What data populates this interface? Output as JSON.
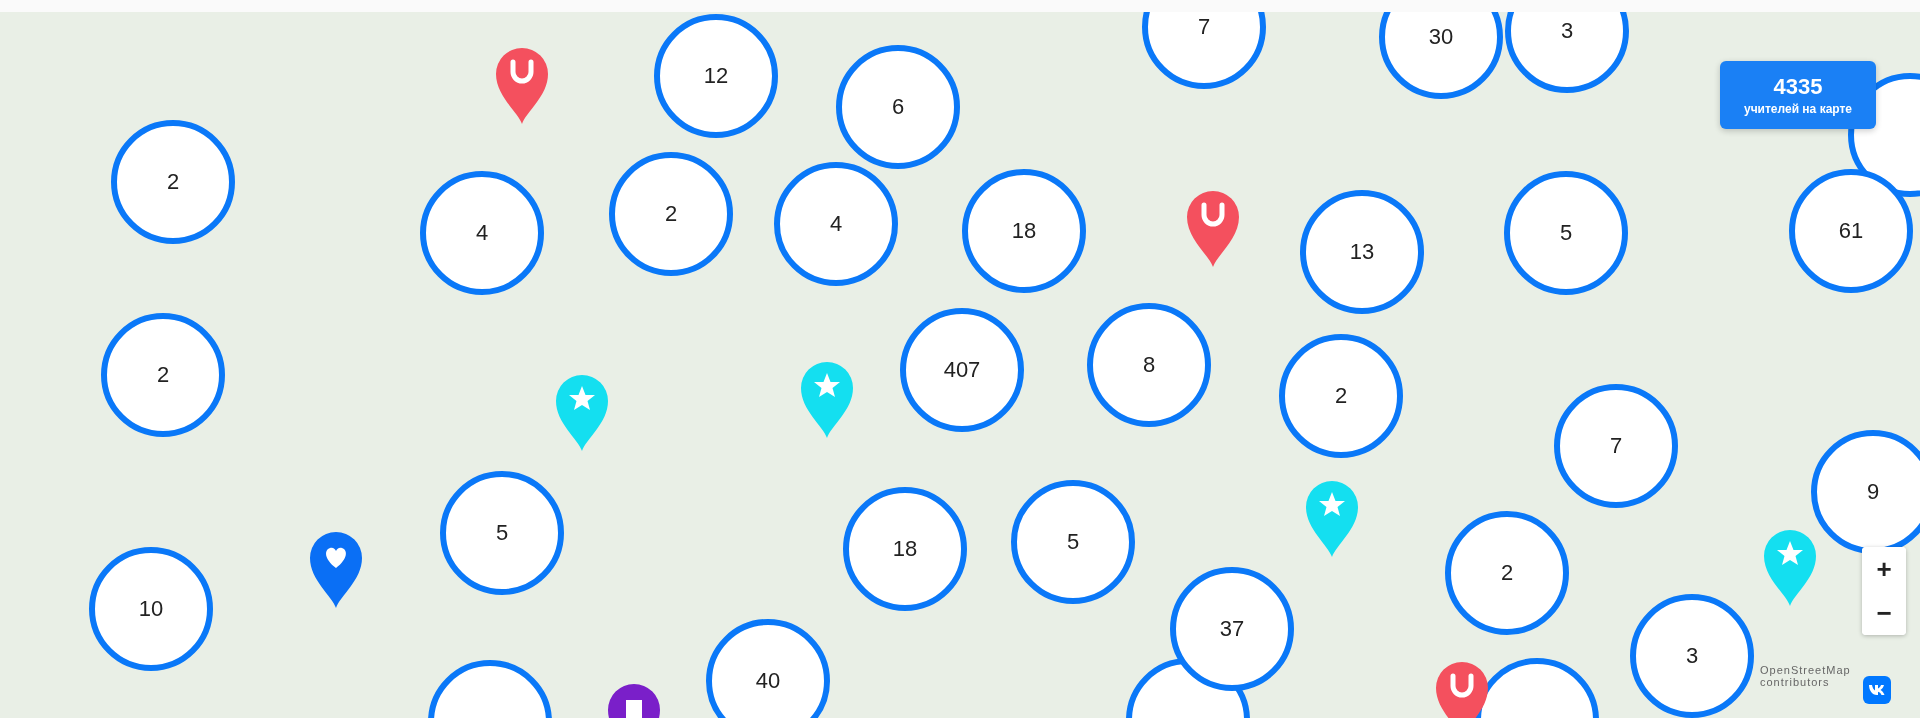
{
  "clusters": [
    {
      "count": "7"
    },
    {
      "count": "30"
    },
    {
      "count": "3"
    },
    {
      "count": "12"
    },
    {
      "count": "6"
    },
    {
      "count": "2"
    },
    {
      "count": "4"
    },
    {
      "count": "2"
    },
    {
      "count": "4"
    },
    {
      "count": "18"
    },
    {
      "count": "13"
    },
    {
      "count": "5"
    },
    {
      "count": "61"
    },
    {
      "count": "2"
    },
    {
      "count": "407"
    },
    {
      "count": "8"
    },
    {
      "count": "2"
    },
    {
      "count": "7"
    },
    {
      "count": "9"
    },
    {
      "count": "5"
    },
    {
      "count": "18"
    },
    {
      "count": "5"
    },
    {
      "count": "2"
    },
    {
      "count": "10"
    },
    {
      "count": "37"
    },
    {
      "count": "40"
    },
    {
      "count": "3"
    }
  ],
  "pins": [
    {
      "kind": "u"
    },
    {
      "kind": "u"
    },
    {
      "kind": "u"
    },
    {
      "kind": "star"
    },
    {
      "kind": "star"
    },
    {
      "kind": "star"
    },
    {
      "kind": "star"
    },
    {
      "kind": "heart"
    },
    {
      "kind": "purple"
    }
  ],
  "counter": {
    "value": "4335",
    "label": "учителей на карте"
  },
  "zoom": {
    "plus": "+",
    "minus": "−"
  },
  "attribution": "OpenStreetMap contributors"
}
